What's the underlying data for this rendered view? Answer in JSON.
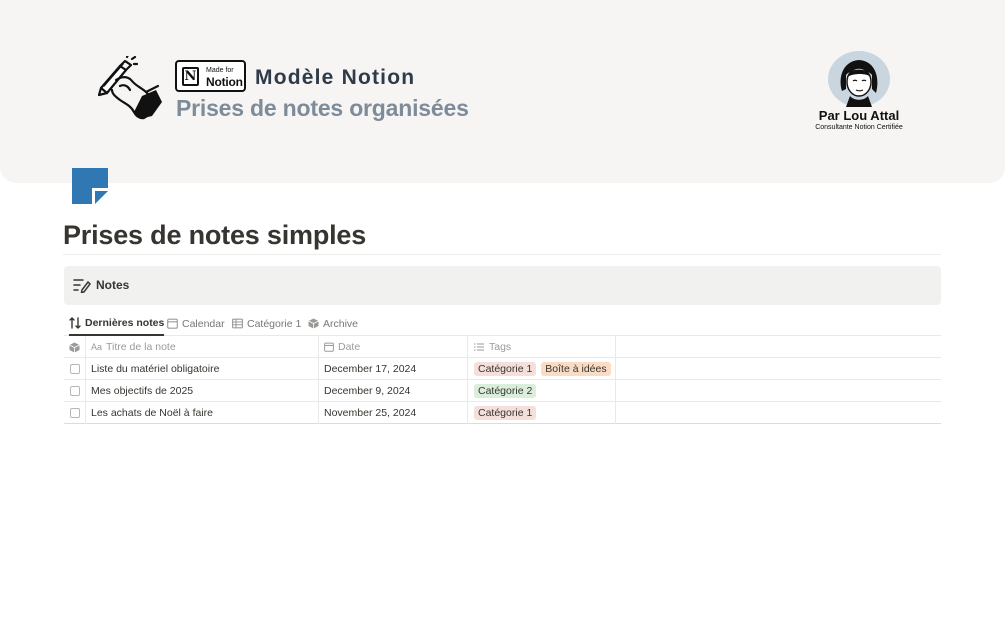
{
  "cover": {
    "badge_small": "Made for",
    "badge_big": "Notion",
    "badge_logo": "N",
    "title": "Modèle Notion",
    "subtitle": "Prises de notes organisées",
    "author": "Par Lou Attal",
    "author_role": "Consultante Notion Certifiée"
  },
  "page": {
    "icon": "folded-page-icon",
    "title": "Prises de notes simples"
  },
  "callout": {
    "label": "Notes",
    "icon": "notes-edit-icon"
  },
  "tabs": [
    {
      "label": "Dernières notes",
      "icon": "sort-icon",
      "active": true
    },
    {
      "label": "Calendar",
      "icon": "calendar-icon",
      "active": false
    },
    {
      "label": "Catégorie 1",
      "icon": "table-icon",
      "active": false
    },
    {
      "label": "Archive",
      "icon": "archive-box-icon",
      "active": false
    }
  ],
  "table": {
    "columns": [
      {
        "label": "",
        "icon": "archive-box-icon"
      },
      {
        "label": "Titre de la note",
        "icon_text": "Aa"
      },
      {
        "label": "Date",
        "icon": "calendar-icon"
      },
      {
        "label": "Tags",
        "icon": "list-icon"
      }
    ],
    "rows": [
      {
        "title": "Liste du matériel obligatoire",
        "date": "December 17, 2024",
        "tags": [
          "Catégorie 1",
          "Boîte à idées"
        ]
      },
      {
        "title": "Mes objectifs de 2025",
        "date": "December 9, 2024",
        "tags": [
          "Catégorie 2"
        ]
      },
      {
        "title": "Les achats de Noël à faire",
        "date": "November 25, 2024",
        "tags": [
          "Catégorie 1"
        ]
      }
    ]
  },
  "tag_colors": {
    "Catégorie 1": "#f4dfdb",
    "Boîte à idées": "#fadcc5",
    "Catégorie 2": "#dbeddb"
  },
  "colors": {
    "accent_blue": "#2f78b4",
    "cover_bg": "#f6f5f4",
    "title_dark": "#2f3b48",
    "title_light": "#7e8b99"
  }
}
